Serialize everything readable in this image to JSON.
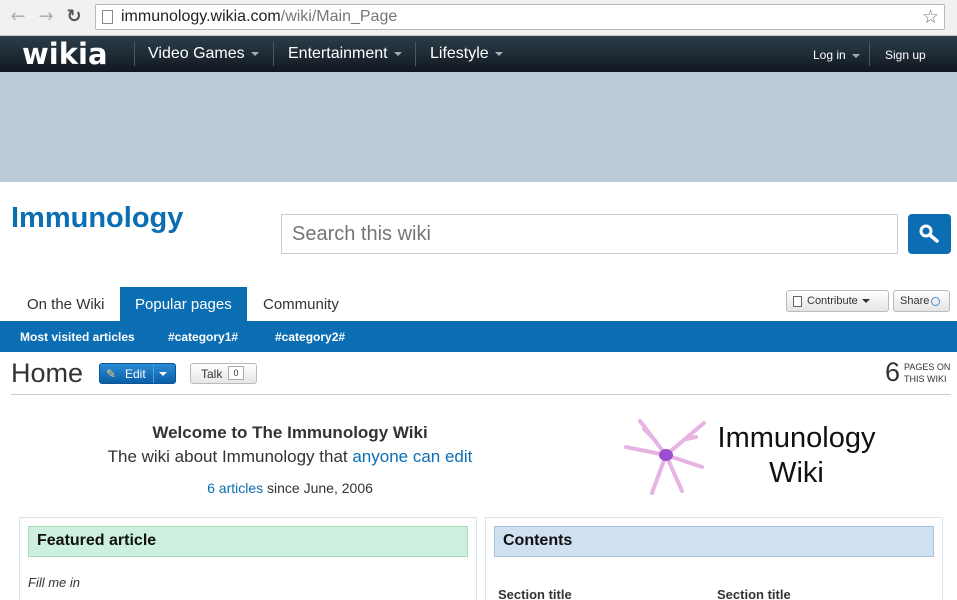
{
  "browser": {
    "url_host": "immunology.wikia.com",
    "url_path": "/wiki/Main_Page"
  },
  "global_nav": {
    "logo": "wikia",
    "items": [
      "Video Games",
      "Entertainment",
      "Lifestyle"
    ],
    "login": "Log in",
    "signup": "Sign up"
  },
  "wiki": {
    "title": "Immunology",
    "search_placeholder": "Search this wiki"
  },
  "tabs": [
    "On the Wiki",
    "Popular pages",
    "Community"
  ],
  "active_tab": "Popular pages",
  "tools": {
    "contribute": "Contribute",
    "share": "Share"
  },
  "subnav": [
    "Most visited articles",
    "#category1#",
    "#category2#"
  ],
  "page": {
    "title": "Home",
    "edit": "Edit",
    "talk": "Talk",
    "talk_count": "0",
    "pages_count": "6",
    "pages_label_1": "PAGES ON",
    "pages_label_2": "THIS WIKI"
  },
  "welcome": {
    "heading": "Welcome to The Immunology Wiki",
    "line_prefix": "The wiki about Immunology that ",
    "line_link": "anyone can edit",
    "articles_link": "6 articles",
    "articles_suffix": " since June, 2006"
  },
  "wiki_logo": {
    "line1": "Immunology",
    "line2": "Wiki"
  },
  "featured": {
    "title": "Featured article",
    "body": "Fill me in"
  },
  "contents": {
    "title": "Contents",
    "sections": [
      "Section title",
      "Section title"
    ]
  },
  "colors": {
    "accent": "#0b6eb3",
    "featured_bg": "#ccf0dd",
    "contents_bg": "#cfe0f1",
    "ad_bg": "#bccbd6"
  }
}
